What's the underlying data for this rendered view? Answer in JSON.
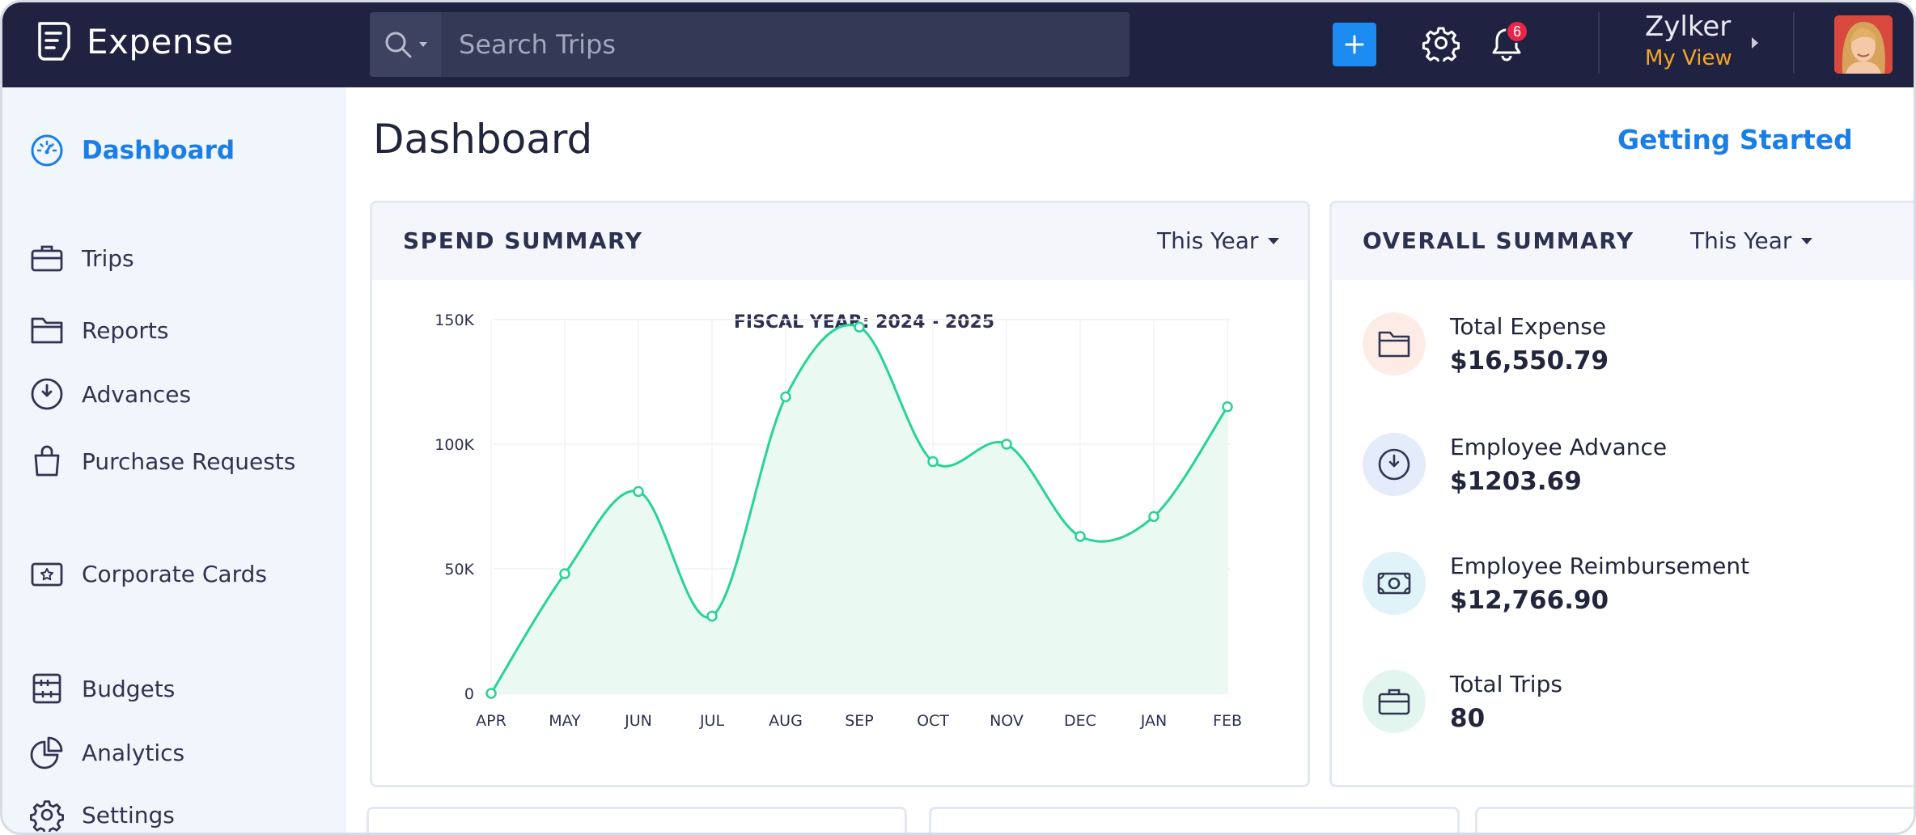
{
  "app": {
    "name": "Expense"
  },
  "search": {
    "placeholder": "Search Trips"
  },
  "header": {
    "notification_count": "6",
    "org_name": "Zylker",
    "org_view": "My View"
  },
  "sidebar": {
    "items": [
      {
        "label": "Dashboard",
        "icon": "dashboard-gauge-icon",
        "active": true
      },
      {
        "label": "Trips",
        "icon": "briefcase-icon"
      },
      {
        "label": "Reports",
        "icon": "folder-icon"
      },
      {
        "label": "Advances",
        "icon": "advance-clock-icon"
      },
      {
        "label": "Purchase Requests",
        "icon": "shopping-bag-icon"
      },
      {
        "label": "Corporate Cards",
        "icon": "card-star-icon"
      },
      {
        "label": "Budgets",
        "icon": "budget-abacus-icon"
      },
      {
        "label": "Analytics",
        "icon": "pie-chart-icon"
      },
      {
        "label": "Settings",
        "icon": "gear-icon"
      }
    ]
  },
  "main": {
    "title": "Dashboard",
    "getting_started": "Getting Started",
    "spend_summary": {
      "title": "SPEND SUMMARY",
      "period": "This Year"
    },
    "overall_summary": {
      "title": "OVERALL SUMMARY",
      "period": "This Year",
      "items": [
        {
          "label": "Total Expense",
          "value": "$16,550.79",
          "icon": "folder-icon",
          "color": "#fdece6"
        },
        {
          "label": "Employee Advance",
          "value": "$1203.69",
          "icon": "advance-clock-icon",
          "color": "#e4ebfb"
        },
        {
          "label": "Employee Reimbursement",
          "value": "$12,766.90",
          "icon": "cash-icon",
          "color": "#dff3f8"
        },
        {
          "label": "Total Trips",
          "value": "80",
          "icon": "briefcase-icon",
          "color": "#e2f6ef"
        }
      ]
    }
  },
  "colors": {
    "topbar": "#1f2341",
    "accent": "#1a7ee8",
    "add_button": "#1c8cf2",
    "org_view": "#f5a623",
    "badge": "#e8264a",
    "chart_line": "#27d395",
    "chart_fill": "#eafaf3"
  },
  "chart_data": {
    "type": "area",
    "title": "FISCAL YEAR: 2024 - 2025",
    "categories": [
      "APR",
      "MAY",
      "JUN",
      "JUL",
      "AUG",
      "SEP",
      "OCT",
      "NOV",
      "DEC",
      "JAN",
      "FEB"
    ],
    "series": [
      {
        "values": [
          0,
          48000,
          81000,
          31000,
          119000,
          147000,
          93000,
          100000,
          63000,
          71000,
          115000
        ]
      }
    ],
    "ylim": [
      0,
      150000
    ],
    "yticks": [
      0,
      50000,
      100000,
      150000
    ],
    "ytick_labels": [
      "0",
      "50K",
      "100K",
      "150K"
    ],
    "grid": true,
    "xlabel": "",
    "ylabel": ""
  }
}
